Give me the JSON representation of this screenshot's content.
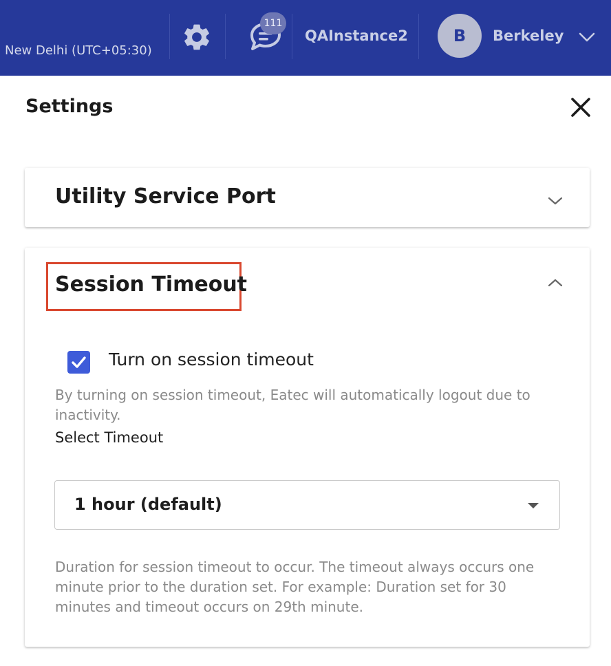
{
  "header": {
    "timezone": "New Delhi (UTC+05:30)",
    "notification_count": "111",
    "instance": "QAInstance2",
    "user_initial": "B",
    "user_name": "Berkeley",
    "bg_color": "#26399a"
  },
  "settings": {
    "title": "Settings",
    "sections": [
      {
        "title": "Utility Service Port",
        "expanded": false
      },
      {
        "title": "Session Timeout",
        "expanded": true,
        "checkbox": {
          "label": "Turn on session timeout",
          "checked": true
        },
        "description": "By turning on session timeout, Eatec will automatically logout due to inactivity.",
        "select_label": "Select Timeout",
        "select_value": "1 hour (default)",
        "help": "Duration for session timeout to occur. The timeout always occurs one minute prior to the duration set. For example: Duration set for 30 minutes and timeout occurs on 29th minute."
      }
    ]
  },
  "icons": [
    "gear-icon",
    "chat-icon",
    "chevron-down-icon",
    "close-icon",
    "chevron-up-icon",
    "checkmark-icon",
    "dropdown-arrow-icon"
  ],
  "colors": {
    "accent": "#3e5bd9",
    "highlight": "#d9482f"
  }
}
